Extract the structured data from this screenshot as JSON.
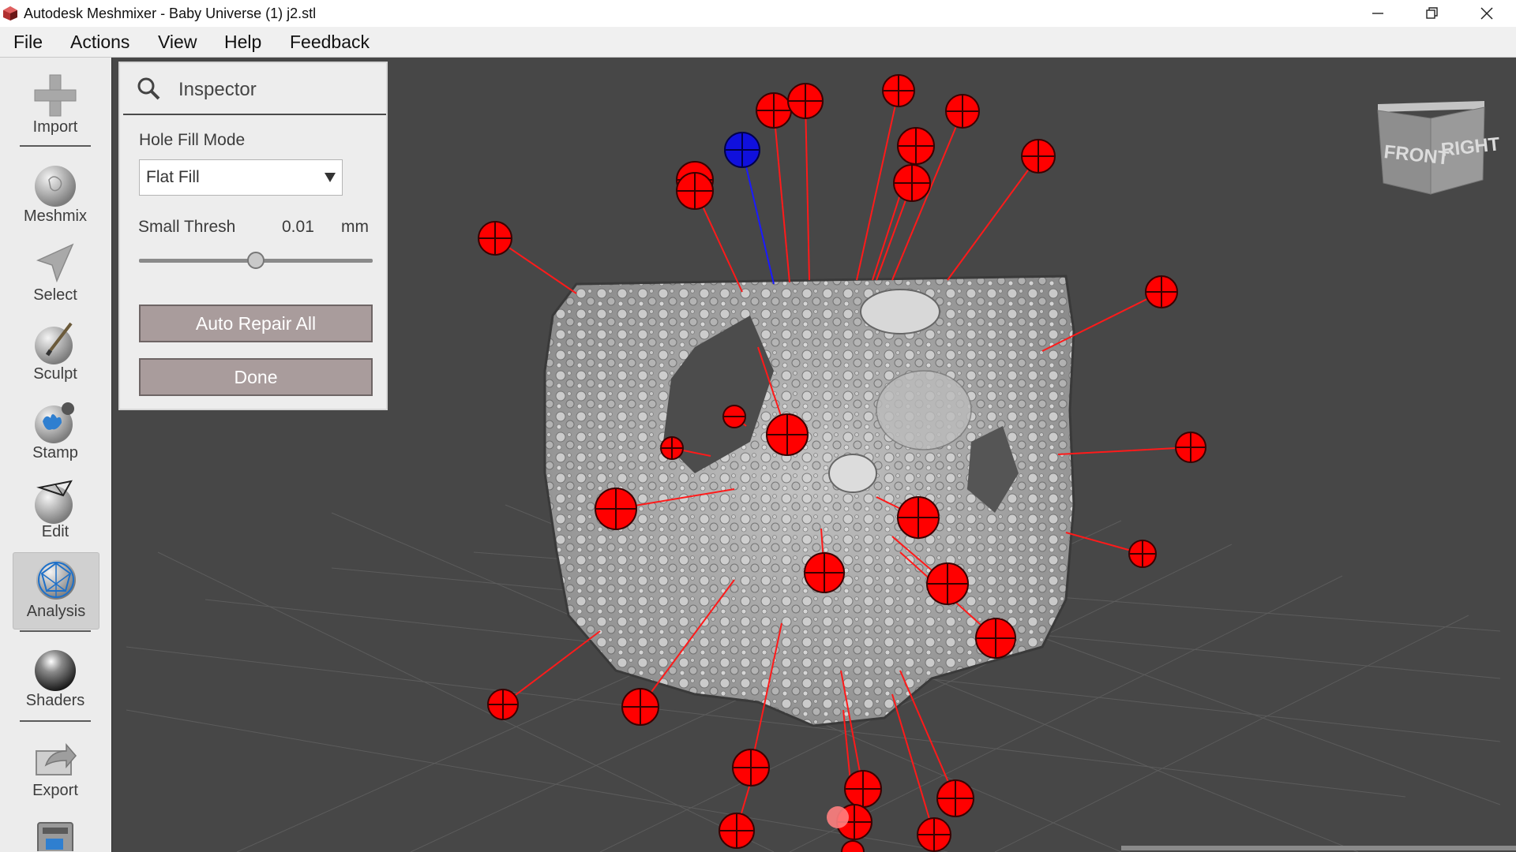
{
  "window": {
    "title": "Autodesk Meshmixer - Baby Universe (1) j2.stl",
    "logo_icon": "meshmixer-logo-icon",
    "controls": [
      "minimize-icon",
      "restore-icon",
      "close-icon"
    ]
  },
  "menu": {
    "items": [
      "File",
      "Actions",
      "View",
      "Help",
      "Feedback"
    ]
  },
  "toolbar": {
    "tools": [
      {
        "label": "Import",
        "icon": "plus-icon"
      },
      {
        "label": "Meshmix",
        "icon": "bunny-sphere-icon"
      },
      {
        "label": "Select",
        "icon": "arrow-cursor-icon"
      },
      {
        "label": "Sculpt",
        "icon": "brush-sphere-icon"
      },
      {
        "label": "Stamp",
        "icon": "stamp-sphere-icon"
      },
      {
        "label": "Edit",
        "icon": "wire-sphere-icon"
      },
      {
        "label": "Analysis",
        "icon": "mesh-sphere-icon",
        "active": true
      },
      {
        "label": "Shaders",
        "icon": "chrome-sphere-icon"
      },
      {
        "label": "Export",
        "icon": "export-icon"
      },
      {
        "label": "",
        "icon": "print-icon"
      }
    ]
  },
  "inspector": {
    "title": "Inspector",
    "icon": "magnifier-icon",
    "hole_fill_mode_label": "Hole Fill Mode",
    "hole_fill_mode_value": "Flat Fill",
    "small_thresh_label": "Small Thresh",
    "small_thresh_value": "0.01",
    "small_thresh_unit": "mm",
    "slider_fraction": 0.5,
    "auto_repair_label": "Auto Repair All",
    "done_label": "Done"
  },
  "viewcube": {
    "front_label": "FRONT",
    "right_label": "RIGHT"
  },
  "colors": {
    "viewport_bg": "#474747",
    "marker_red": "#ff0000",
    "marker_blue": "#1010dd",
    "mesh_gray": "#a6a6a6"
  }
}
